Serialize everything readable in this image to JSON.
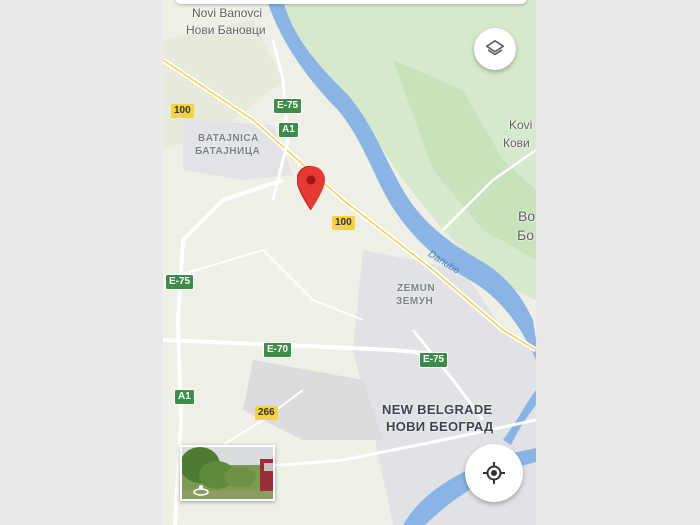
{
  "map": {
    "places": [
      {
        "latin": "Novi Banovci",
        "cyrillic": "Нови Бановци"
      },
      {
        "latin": "Batajnica",
        "cyrillic": "Батајница"
      },
      {
        "latin": "Zemun",
        "cyrillic": "Земун"
      },
      {
        "latin": "New Belgrade",
        "cyrillic": "Нови Београд"
      },
      {
        "latin": "Kovi",
        "cyrillic": "Кови"
      },
      {
        "latin": "Bo",
        "cyrillic": "Бо"
      }
    ],
    "labels": {
      "novi_banovci": "Novi Banovci",
      "novi_banovci_cyr": "Нови Бановци",
      "batajnica": "BATAJNICA",
      "batajnica_cyr": "БАТАЈНИЦА",
      "zemun": "ZEMUN",
      "zemun_cyr": "ЗЕМУН",
      "new_belgrade": "NEW BELGRADE",
      "new_belgrade_cyr": "НОВИ БЕОГРАД",
      "kovi": "Kovi",
      "kovi_cyr": "Кови",
      "bo": "Bo",
      "bo_cyr": "Бо",
      "danube": "Danube"
    },
    "road_shields": {
      "r100_a": "100",
      "r100_b": "100",
      "r266": "266",
      "e75_a": "E-75",
      "e75_b": "E-75",
      "e75_c": "E-75",
      "e70": "E-70",
      "a1_a": "A1",
      "a1_b": "A1"
    },
    "colors": {
      "land": "#eef0e6",
      "park": "#cfe5c4",
      "water": "#8ab4e3",
      "road": "#ffffff",
      "highway": "#f6d46a",
      "urban": "#e3e3e6",
      "pin": "#e53935"
    },
    "controls": {
      "layers_icon": "layers-icon",
      "locate_icon": "my-location-icon",
      "street_view_icon": "street-view-360-icon"
    }
  }
}
